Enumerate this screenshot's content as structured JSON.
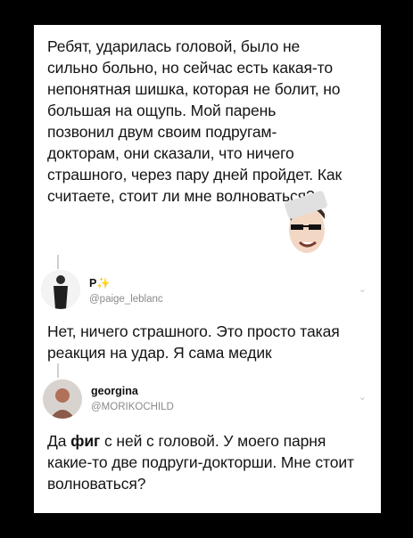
{
  "post": {
    "text": "Ребят, ударилась головой, было не сильно больно, но сейчас есть какая-то непонятная шишка, которая не болит, но большая на ощупь. Мой парень позвонил двум своим подругам-докторам, они сказали, что ничего страшного, через пару дней пройдет. Как считаете, стоит ли мне волноваться?"
  },
  "sticker": {
    "lettering": "DEAL WITH IT"
  },
  "reply1": {
    "name": "P✨",
    "handle": "@paige_leblanc",
    "text": "Нет, ничего страшного. Это просто такая реакция на удар. Я сама медик"
  },
  "reply2": {
    "name": "georgina",
    "handle": "@MORIKOCHILD",
    "text_bold": "фиг",
    "text_before": "Да ",
    "text_after": " с ней с головой. У моего парня какие-то две подруги-докторши. Мне стоит волноваться?"
  },
  "icons": [
    "chevron-down-icon",
    "avatar",
    "sticker-face"
  ],
  "colors": {
    "background": "#000000",
    "card": "#ffffff",
    "text": "#141414",
    "muted": "#8a8a8a"
  }
}
